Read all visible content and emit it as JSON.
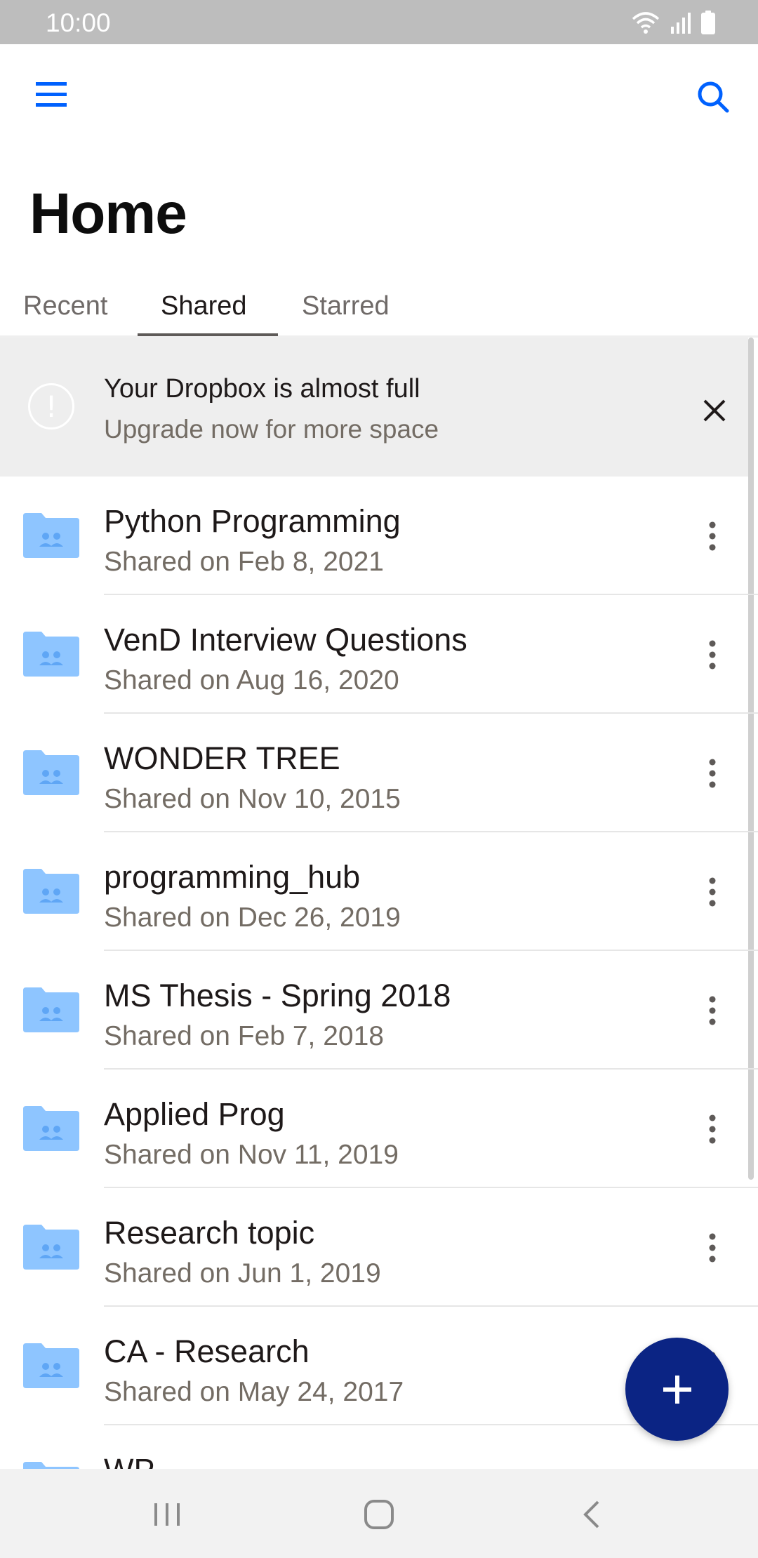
{
  "status_bar": {
    "time": "10:00"
  },
  "colors": {
    "accent": "#0061fe",
    "fab": "#0b2484",
    "folder": "#8ec5ff",
    "folder_dark": "#5fa6f5"
  },
  "app_bar": {
    "menu_icon": "hamburger-menu-icon",
    "search_icon": "search-icon"
  },
  "page": {
    "title": "Home"
  },
  "tabs": [
    {
      "label": "Recent",
      "active": false
    },
    {
      "label": "Shared",
      "active": true
    },
    {
      "label": "Starred",
      "active": false
    }
  ],
  "banner": {
    "title": "Your Dropbox is almost full",
    "subtitle": "Upgrade now for more space",
    "icon": "alert-icon",
    "close_icon": "close-icon"
  },
  "items": [
    {
      "name": "Python Programming",
      "date": "Shared on Feb 8, 2021"
    },
    {
      "name": "VenD Interview Questions",
      "date": "Shared on Aug 16, 2020"
    },
    {
      "name": "WONDER TREE",
      "date": "Shared on Nov 10, 2015"
    },
    {
      "name": "programming_hub",
      "date": "Shared on Dec 26, 2019"
    },
    {
      "name": "MS Thesis - Spring 2018",
      "date": "Shared on Feb 7, 2018"
    },
    {
      "name": "Applied Prog",
      "date": "Shared on Nov 11, 2019"
    },
    {
      "name": "Research topic",
      "date": "Shared on Jun 1, 2019"
    },
    {
      "name": "CA - Research",
      "date": "Shared on May 24, 2017"
    },
    {
      "name": "WP",
      "date": ""
    }
  ],
  "fab": {
    "icon": "plus-icon"
  },
  "nav_bar": {
    "recents_icon": "recent-apps-icon",
    "home_icon": "home-icon",
    "back_icon": "back-icon"
  }
}
